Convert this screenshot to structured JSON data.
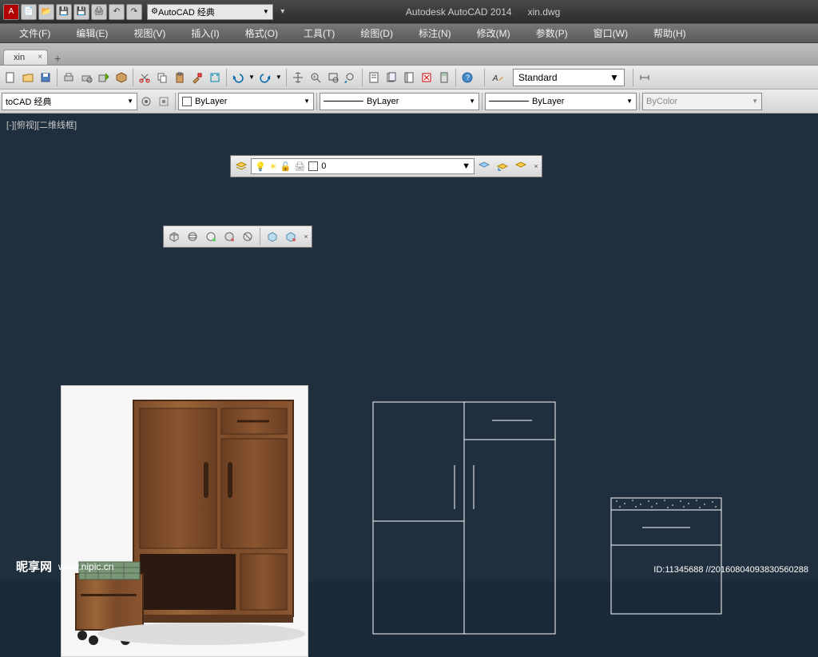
{
  "title": {
    "app": "Autodesk AutoCAD 2014",
    "file": "xin.dwg"
  },
  "workspace": "AutoCAD 经典",
  "menu": [
    "文件(F)",
    "编辑(E)",
    "视图(V)",
    "插入(I)",
    "格式(O)",
    "工具(T)",
    "绘图(D)",
    "标注(N)",
    "修改(M)",
    "参数(P)",
    "窗口(W)",
    "帮助(H)"
  ],
  "tab": {
    "name": "xin"
  },
  "row2": {
    "workspace": "toCAD 经典",
    "layer_color": "ByLayer",
    "linetype": "ByLayer",
    "lineweight": "ByLayer",
    "plotstyle": "ByColor"
  },
  "style": "Standard",
  "viewport": "[-][俯视][二维线框]",
  "layers_panel": {
    "current": "0"
  },
  "watermark": {
    "site": "昵享网",
    "url": "www.nipic.cn",
    "id": "ID:11345688 //20160804093830560288"
  }
}
